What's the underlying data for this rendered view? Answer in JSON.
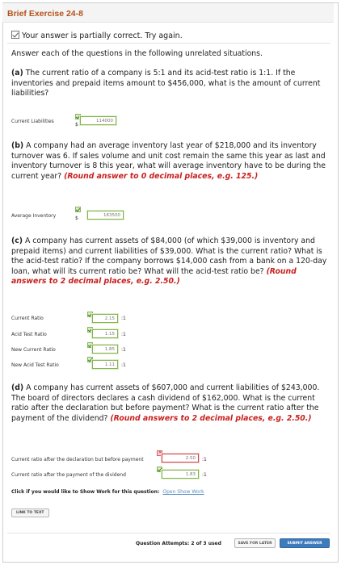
{
  "title": "Brief Exercise 24-8",
  "status": "Your answer is partially correct.  Try again.",
  "intro": "Answer each of the questions in the following unrelated situations.",
  "parts": {
    "a": {
      "label": "(a)",
      "text": " The current ratio of a company is 5:1 and its acid-test ratio is 1:1. If the inventories and prepaid items amount to $456,000, what is the amount of current liabilities?",
      "row_label": "Current Liabilities",
      "currency": "$",
      "value": "114000"
    },
    "b": {
      "label": "(b)",
      "text": " A company had an average inventory last year of $218,000 and its inventory turnover was 6. If sales volume and unit cost remain the same this year as last and inventory turnover is 8 this year, what will average inventory have to be during the current year? ",
      "instruction": "(Round answer to 0 decimal places, e.g. 125.)",
      "row_label": "Average Inventory",
      "currency": "$",
      "value": "163500"
    },
    "c": {
      "label": "(c)",
      "text": " A company has current assets of $84,000 (of which $39,000 is inventory and prepaid items) and current liabilities of $39,000. What is the current ratio? What is the acid-test ratio? If the company borrows $14,000 cash from a bank on a 120-day loan, what will its current ratio be? What will the acid-test ratio be? ",
      "instruction": "(Round answers to 2 decimal places, e.g. 2.50.)",
      "rows": [
        {
          "label": "Current Ratio",
          "value": "2.15",
          "suffix": ":1"
        },
        {
          "label": "Acid Test Ratio",
          "value": "1.15",
          "suffix": ":1"
        },
        {
          "label": "New Current Ratio",
          "value": "1.85",
          "suffix": ":1"
        },
        {
          "label": "New Acid Test Ratio",
          "value": "1.11",
          "suffix": ":1"
        }
      ]
    },
    "d": {
      "label": "(d)",
      "text": " A company has current assets of $607,000 and current liabilities of $243,000. The board of directors declares a cash dividend of $162,000. What is the current ratio after the declaration but before payment? What is the current ratio after the payment of the dividend? ",
      "instruction": "(Round answers to 2 decimal places, e.g. 2.50.)",
      "rows": [
        {
          "label": "Current ratio after the declaration but before payment",
          "value": "2.50",
          "suffix": ":1"
        },
        {
          "label": "Current ratio after the payment of the dividend",
          "value": "1.83",
          "suffix": ":1"
        }
      ]
    }
  },
  "work_prompt": "Click if you would like to Show Work for this question:",
  "work_link": "Open Show Work",
  "link_to_text": "LINK TO TEXT",
  "attempts": "Question Attempts: 2 of 3 used",
  "save_later": "SAVE FOR LATER",
  "submit": "SUBMIT ANSWER"
}
